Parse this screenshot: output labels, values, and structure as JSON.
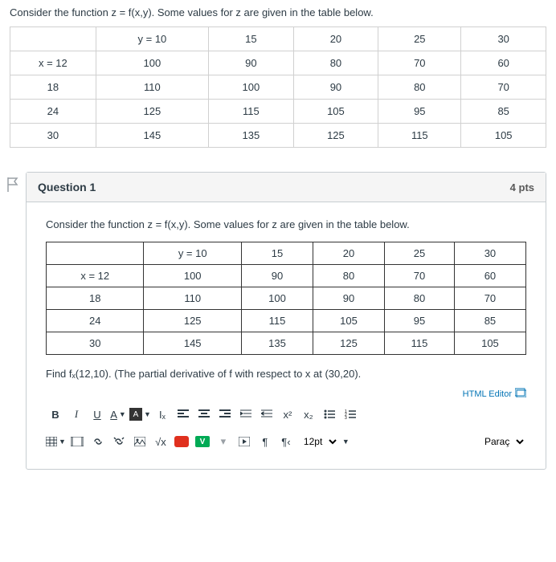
{
  "top": {
    "prompt": "Consider the function z = f(x,y). Some values for z are given in the table below.",
    "headers": [
      "",
      "y = 10",
      "15",
      "20",
      "25",
      "30"
    ],
    "rows": [
      [
        "x = 12",
        "100",
        "90",
        "80",
        "70",
        "60"
      ],
      [
        "18",
        "110",
        "100",
        "90",
        "80",
        "70"
      ],
      [
        "24",
        "125",
        "115",
        "105",
        "95",
        "85"
      ],
      [
        "30",
        "145",
        "135",
        "125",
        "115",
        "105"
      ]
    ]
  },
  "question": {
    "title": "Question 1",
    "points": "4 pts",
    "prompt": "Consider the function z = f(x,y). Some values for z are given in the table below.",
    "headers": [
      "",
      "y = 10",
      "15",
      "20",
      "25",
      "30"
    ],
    "rows": [
      [
        "x = 12",
        "100",
        "90",
        "80",
        "70",
        "60"
      ],
      [
        "18",
        "110",
        "100",
        "90",
        "80",
        "70"
      ],
      [
        "24",
        "125",
        "115",
        "105",
        "95",
        "85"
      ],
      [
        "30",
        "145",
        "135",
        "125",
        "115",
        "105"
      ]
    ],
    "find": "Find fₓ(12,10). (The partial derivative of f with respect to x at (30,20).",
    "editor_label": "HTML Editor"
  },
  "toolbar": {
    "bold": "B",
    "italic": "I",
    "underline": "U",
    "textcolor": "A",
    "bgcolor": "A",
    "clear": "Iₓ",
    "sup": "x²",
    "sub": "x₂",
    "sqrt": "√x",
    "pi": "¶",
    "pi2": "¶‹",
    "fontsize": "12pt",
    "para": "Paraç",
    "v": "V"
  }
}
